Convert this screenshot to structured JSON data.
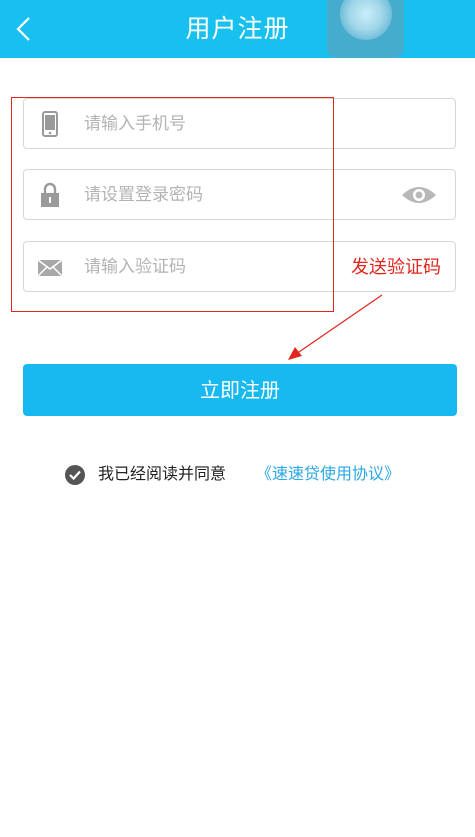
{
  "header": {
    "title": "用户注册",
    "back_icon": "chevron-left-icon"
  },
  "form": {
    "phone_placeholder": "请输入手机号",
    "password_placeholder": "请设置登录密码",
    "code_placeholder": "请输入验证码",
    "send_code_label": "发送验证码"
  },
  "submit_label": "立即注册",
  "agreement": {
    "text": "我已经阅读并同意",
    "link": "《速速贷使用协议》",
    "checked": true
  },
  "colors": {
    "brand": "#18c0f0",
    "button": "#18b8f1",
    "link": "#2aa7e6",
    "annotation_red": "#e0261d"
  }
}
